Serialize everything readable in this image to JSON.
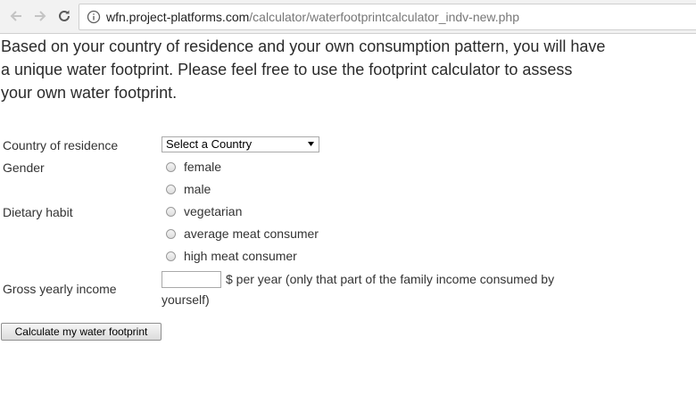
{
  "browser": {
    "url_host": "wfn.project-platforms.com",
    "url_path": "/calculator/waterfootprintcalculator_indv-new.php",
    "icons": {
      "back": "arrow-left-icon",
      "forward": "arrow-right-icon",
      "reload": "reload-icon",
      "info": "info-icon"
    }
  },
  "intro": {
    "line1": "Based on your country of residence and your own consumption pattern, you will have",
    "line2": "a unique water footprint. Please feel free to use the footprint calculator to assess",
    "line3": "your own water footprint."
  },
  "form": {
    "country_label": "Country of residence",
    "country_select": "Select a Country",
    "gender_label": "Gender",
    "gender_options": [
      "female",
      "male"
    ],
    "diet_label": "Dietary habit",
    "diet_options": [
      "vegetarian",
      "average meat consumer",
      "high meat consumer"
    ],
    "income_label": "Gross yearly income",
    "income_value": "",
    "income_note_line1": "$ per year (only that part of the family income consumed by",
    "income_note_line2": "yourself)",
    "submit_label": "Calculate my water footprint"
  },
  "colors": {
    "text": "#333333",
    "url_path": "#777777",
    "toolbar": "#f2f2f2"
  }
}
